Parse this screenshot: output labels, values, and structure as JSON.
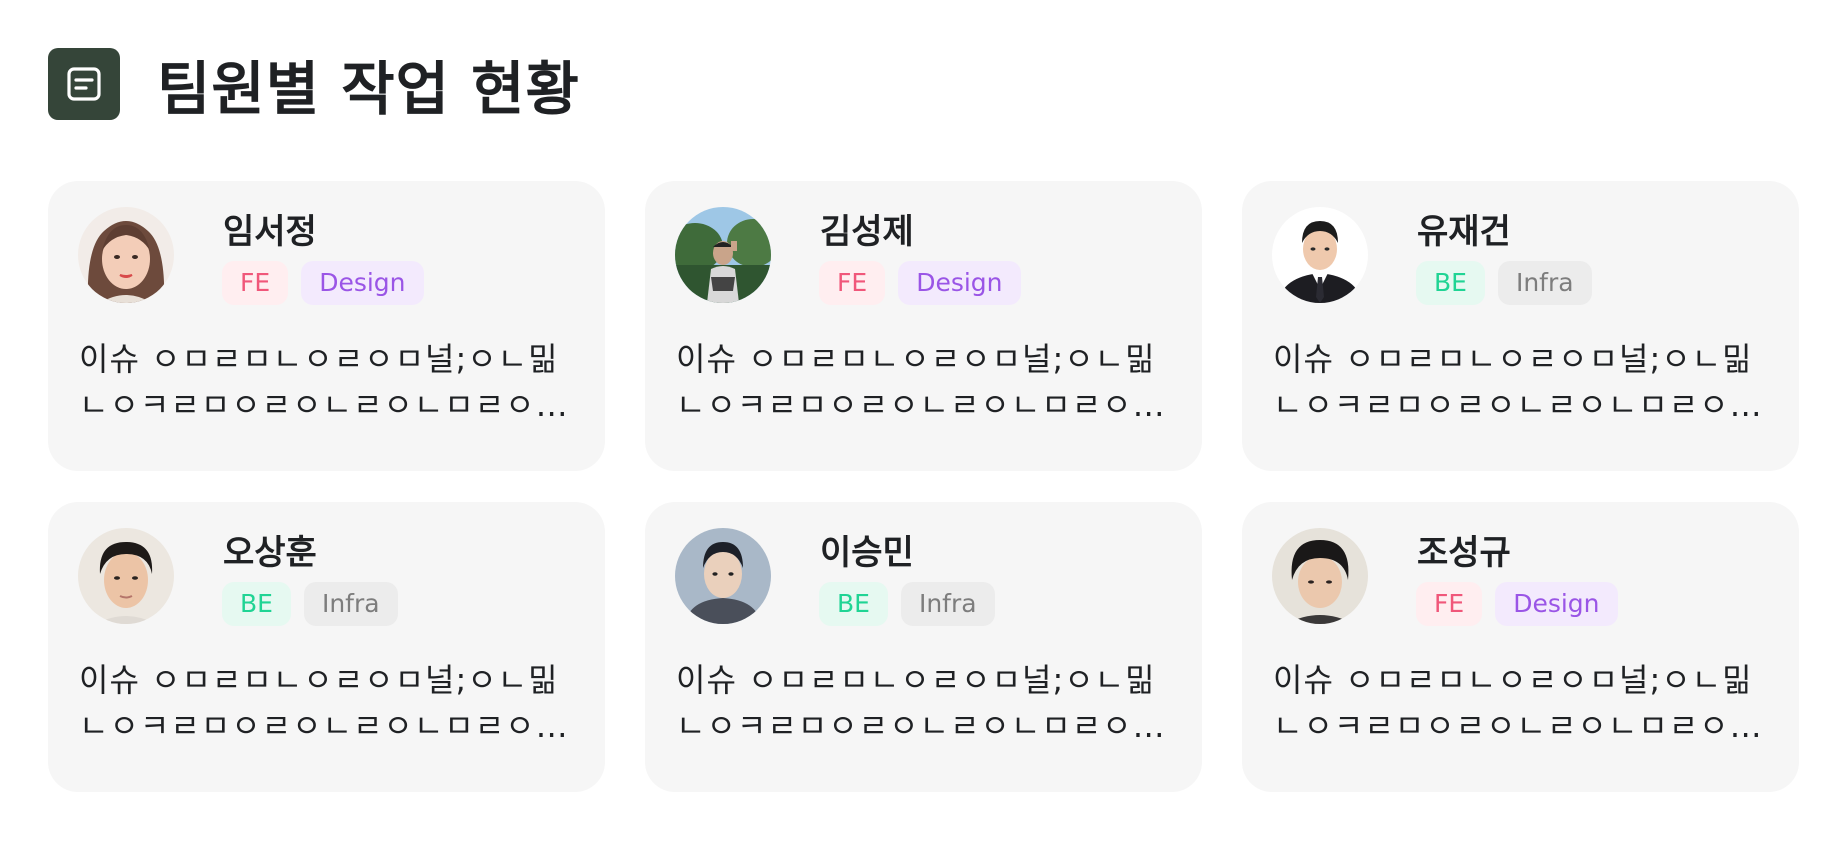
{
  "header": {
    "title": "팀원별 작업 현황",
    "icon": "document-icon",
    "icon_color": "#354539"
  },
  "members": [
    {
      "name": "임서정",
      "tags": [
        "FE",
        "Design"
      ],
      "description": "이슈 ㅇㅁㄹㅁㄴㅇㄹㅇㅁ널;ㅇㄴ밂ㄴㅇㅋㄹㅁㅇㄹㅇㄴㄹㅇㄴㅁㄹㅇㄴㄹㅇㅁ",
      "avatar": "avatar-photo"
    },
    {
      "name": "김성제",
      "tags": [
        "FE",
        "Design"
      ],
      "description": "이슈 ㅇㅁㄹㅁㄴㅇㄹㅇㅁ널;ㅇㄴ밂ㄴㅇㅋㄹㅁㅇㄹㅇㄴㄹㅇㄴㅁㄹㅇㄴㄹㅇㅁ",
      "avatar": "avatar-photo"
    },
    {
      "name": "유재건",
      "tags": [
        "BE",
        "Infra"
      ],
      "description": "이슈 ㅇㅁㄹㅁㄴㅇㄹㅇㅁ널;ㅇㄴ밂ㄴㅇㅋㄹㅁㅇㄹㅇㄴㄹㅇㄴㅁㄹㅇㄴㄹㅇㅁ",
      "avatar": "avatar-photo"
    },
    {
      "name": "오상훈",
      "tags": [
        "BE",
        "Infra"
      ],
      "description": "이슈 ㅇㅁㄹㅁㄴㅇㄹㅇㅁ널;ㅇㄴ밂ㄴㅇㅋㄹㅁㅇㄹㅇㄴㄹㅇㄴㅁㄹㅇㄴㄹㅇㅁ",
      "avatar": "avatar-photo"
    },
    {
      "name": "이승민",
      "tags": [
        "BE",
        "Infra"
      ],
      "description": "이슈 ㅇㅁㄹㅁㄴㅇㄹㅇㅁ널;ㅇㄴ밂ㄴㅇㅋㄹㅁㅇㄹㅇㄴㄹㅇㄴㅁㄹㅇㄴㄹㅇㅁ",
      "avatar": "avatar-photo"
    },
    {
      "name": "조성규",
      "tags": [
        "FE",
        "Design"
      ],
      "description": "이슈 ㅇㅁㄹㅁㄴㅇㄹㅇㅁ널;ㅇㄴ밂ㄴㅇㅋㄹㅁㅇㄹㅇㄴㄹㅇㄴㅁㄹㅇㄴㄹㅇㅁ",
      "avatar": "avatar-photo"
    }
  ],
  "tag_colors": {
    "FE": {
      "bg": "#ffeef0",
      "fg": "#f0577a"
    },
    "Design": {
      "bg": "#f3eafd",
      "fg": "#9a55e6"
    },
    "BE": {
      "bg": "#e6f9f1",
      "fg": "#20d494"
    },
    "Infra": {
      "bg": "#ececec",
      "fg": "#7d7d7d"
    }
  }
}
